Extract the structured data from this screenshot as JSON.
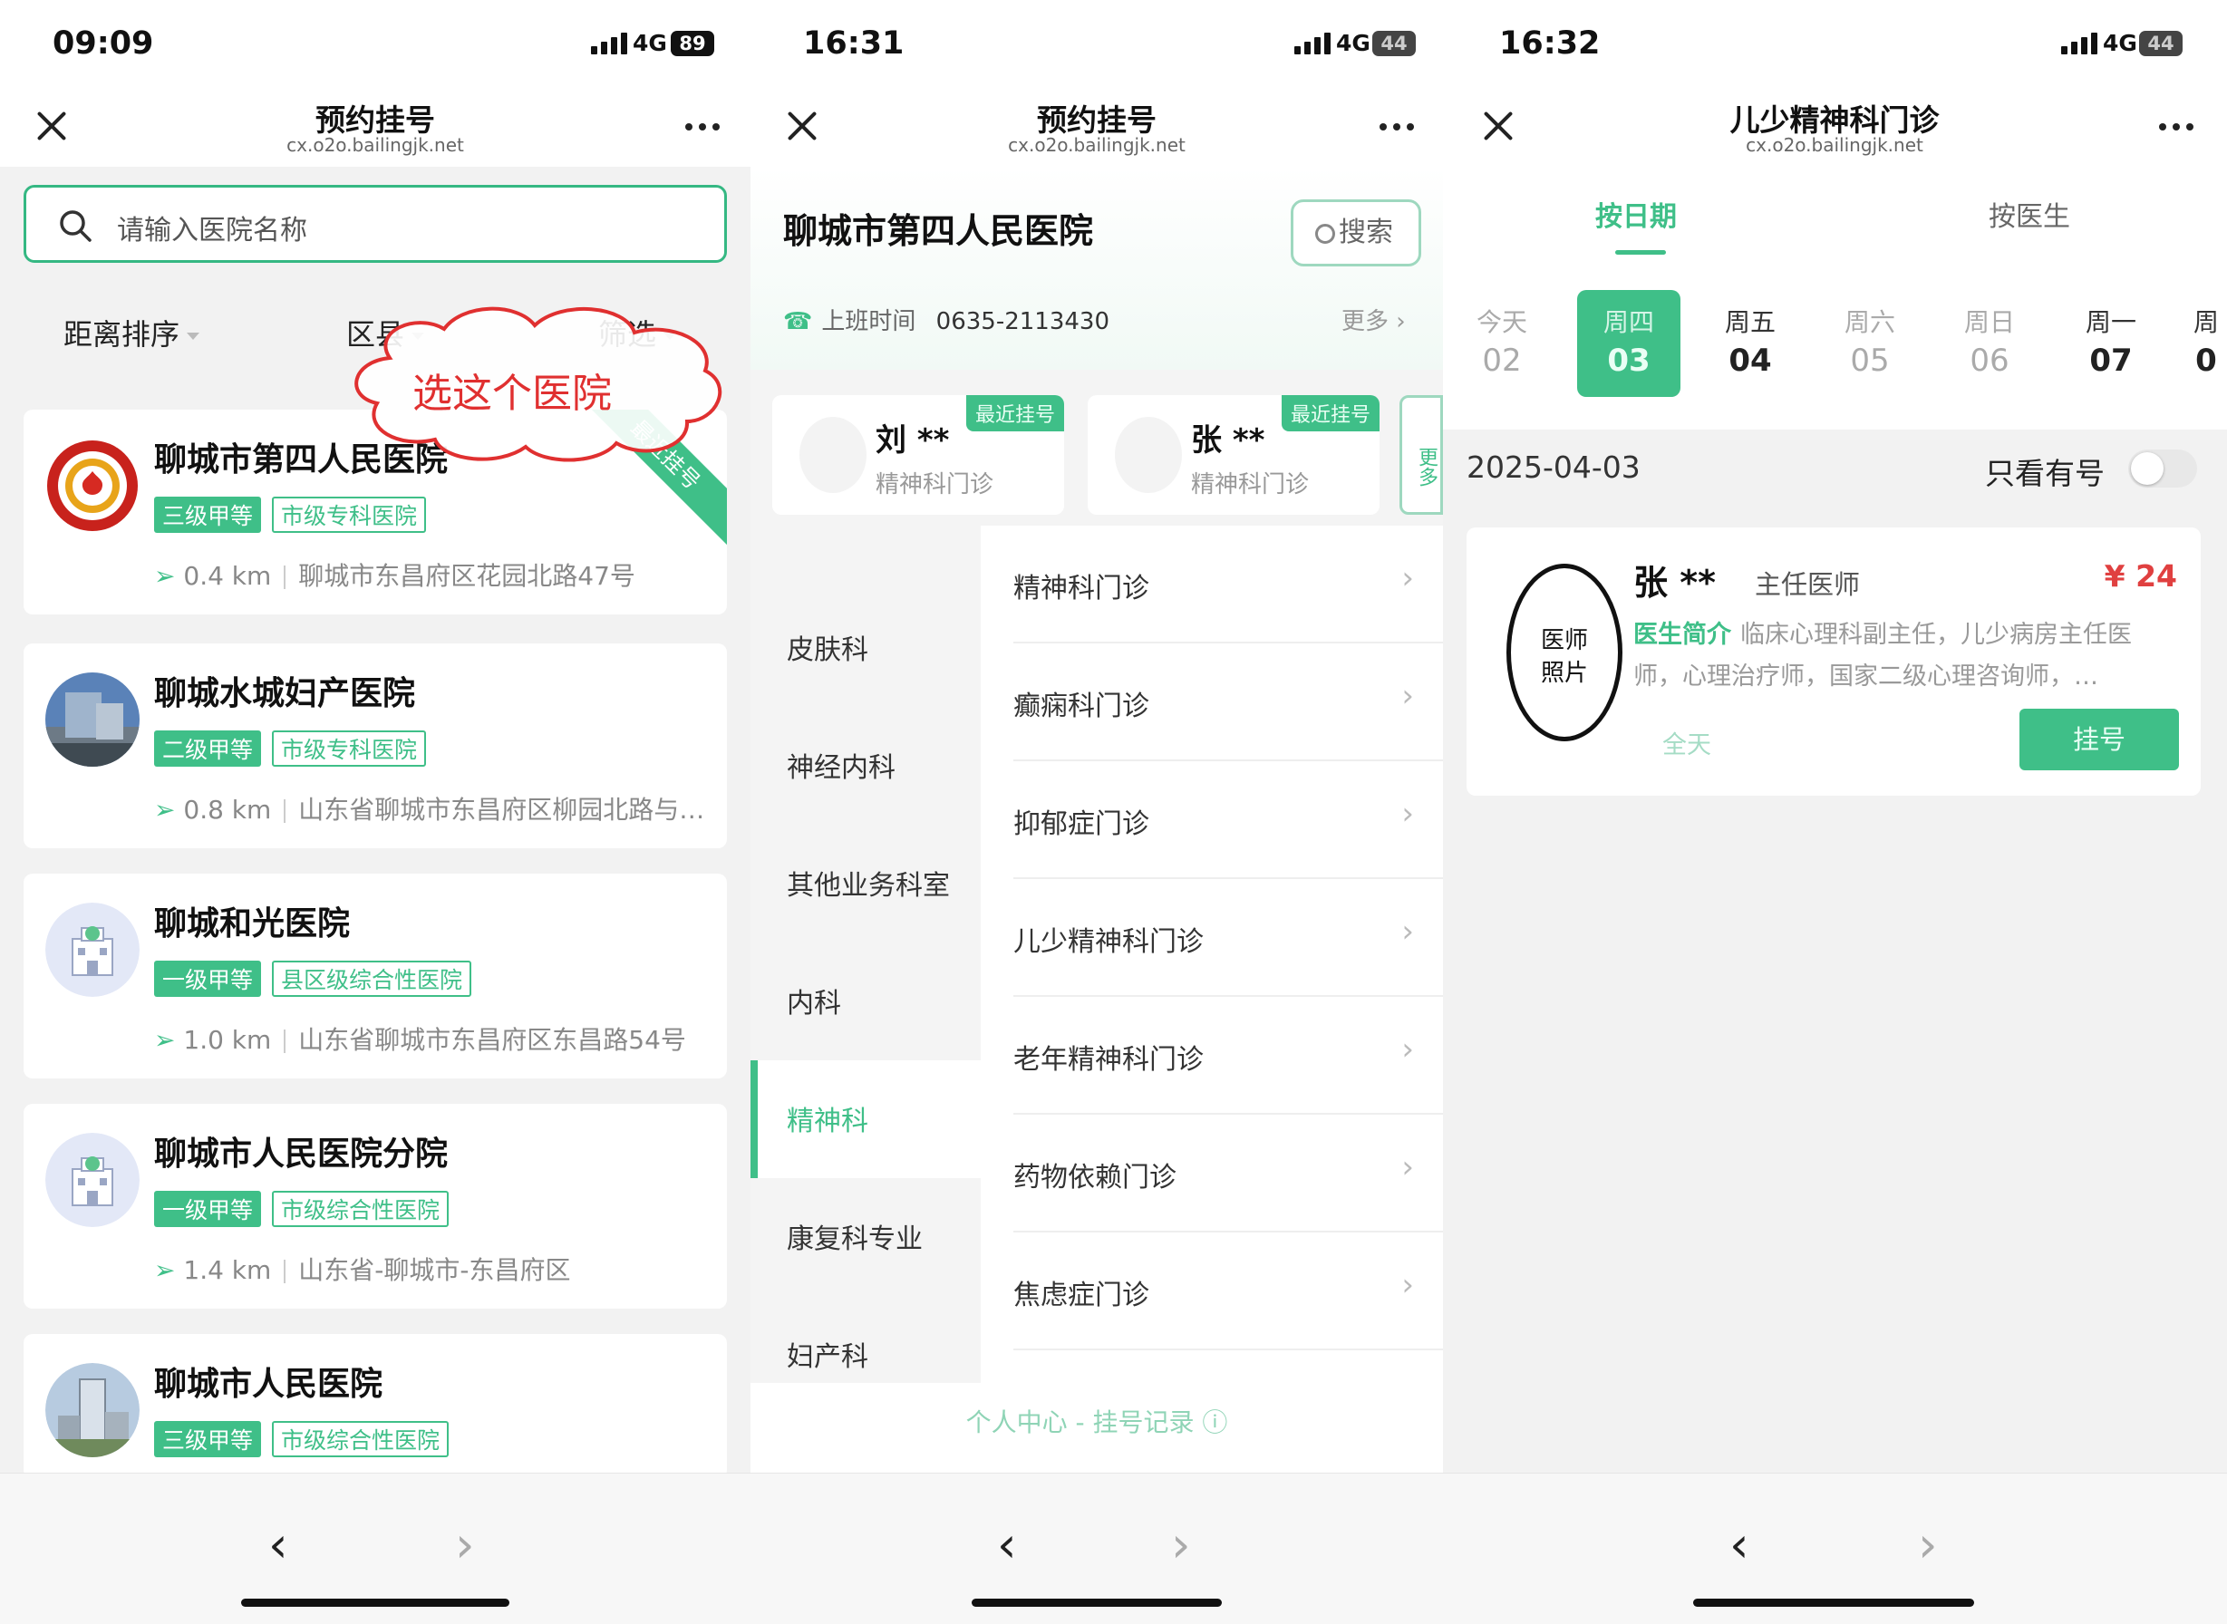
{
  "panel1": {
    "status": {
      "time": "09:09",
      "network": "4G",
      "battery": "89"
    },
    "nav": {
      "title": "预约挂号",
      "url": "cx.o2o.bailingjk.net"
    },
    "search": {
      "placeholder": "请输入医院名称"
    },
    "filters": [
      "距离排序",
      "区县",
      "筛选"
    ],
    "annotation": "选这个医院",
    "hospitals": [
      {
        "name": "聊城市第四人民医院",
        "grade": "三级甲等",
        "type": "市级专科医院",
        "distance": "0.4 km",
        "address": "聊城市东昌府区花园北路47号",
        "ribbon": "最近挂号",
        "logo": "hospital-emblem-icon"
      },
      {
        "name": "聊城水城妇产医院",
        "grade": "二级甲等",
        "type": "市级专科医院",
        "distance": "0.8 km",
        "address": "山东省聊城市东昌府区柳园北路与…",
        "logo": "hospital-building-photo"
      },
      {
        "name": "聊城和光医院",
        "grade": "一级甲等",
        "type": "县区级综合性医院",
        "distance": "1.0 km",
        "address": "山东省聊城市东昌府区东昌路54号",
        "logo": "hospital-default-icon"
      },
      {
        "name": "聊城市人民医院分院",
        "grade": "一级甲等",
        "type": "市级综合性医院",
        "distance": "1.4 km",
        "address": "山东省-聊城市-东昌府区",
        "logo": "hospital-default-icon"
      },
      {
        "name": "聊城市人民医院",
        "grade": "三级甲等",
        "type": "市级综合性医院",
        "distance": "",
        "address": "",
        "logo": "hospital-tower-photo"
      }
    ]
  },
  "panel2": {
    "status": {
      "time": "16:31",
      "network": "4G",
      "battery": "44"
    },
    "nav": {
      "title": "预约挂号",
      "url": "cx.o2o.bailingjk.net"
    },
    "hospital": {
      "name": "聊城市第四人民医院",
      "search_label": "搜索",
      "hours_label": "上班时间",
      "phone": "0635-2113430",
      "more": "更多 ›"
    },
    "recent": [
      {
        "name": "刘 **",
        "dept": "精神科门诊",
        "badge": "最近挂号"
      },
      {
        "name": "张 **",
        "dept": "精神科门诊",
        "badge": "最近挂号"
      }
    ],
    "recent_more": "更多",
    "departments": [
      "皮肤科",
      "神经内科",
      "其他业务科室",
      "内科",
      "精神科",
      "康复科专业",
      "妇产科"
    ],
    "active_department": "精神科",
    "sub_departments": [
      "精神科门诊",
      "癫痫科门诊",
      "抑郁症门诊",
      "儿少精神科门诊",
      "老年精神科门诊",
      "药物依赖门诊",
      "焦虑症门诊"
    ],
    "footer_link": "个人中心 - 挂号记录 ⓘ"
  },
  "panel3": {
    "status": {
      "time": "16:32",
      "network": "4G",
      "battery": "44"
    },
    "nav": {
      "title": "儿少精神科门诊",
      "url": "cx.o2o.bailingjk.net"
    },
    "tabs": [
      "按日期",
      "按医生"
    ],
    "active_tab": "按日期",
    "days": [
      {
        "weekday": "今天",
        "date": "02",
        "state": "dim"
      },
      {
        "weekday": "周四",
        "date": "03",
        "state": "selected"
      },
      {
        "weekday": "周五",
        "date": "04",
        "state": "available"
      },
      {
        "weekday": "周六",
        "date": "05",
        "state": "dim"
      },
      {
        "weekday": "周日",
        "date": "06",
        "state": "dim"
      },
      {
        "weekday": "周一",
        "date": "07",
        "state": "available"
      },
      {
        "weekday": "周",
        "date": "0",
        "state": "available"
      }
    ],
    "date": "2025-04-03",
    "only_available_label": "只看有号",
    "only_available_on": false,
    "doctor": {
      "photo_label": "医师\n照片",
      "name": "张 **",
      "title": "主任医师",
      "price": "¥ 24",
      "intro_label": "医生简介",
      "intro": "临床心理科副主任，儿少病房主任医师，心理治疗师，国家二级心理咨询师，…",
      "session": "全天",
      "button": "挂号"
    }
  },
  "colors": {
    "accent": "#3fbf88",
    "price": "#e04040",
    "annotation": "#e03030"
  }
}
